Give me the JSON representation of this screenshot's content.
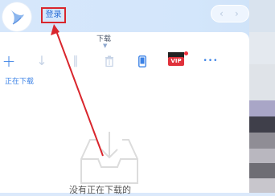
{
  "header": {
    "login_label": "登录",
    "back_symbol": "‹",
    "forward_symbol": "›"
  },
  "tabs": {
    "active_label": "下载"
  },
  "toolbar": {
    "items": [
      {
        "icon": "plus-icon",
        "glyph": "+",
        "enabled": true
      },
      {
        "icon": "download-arrow-icon",
        "glyph": "↓",
        "enabled": false
      },
      {
        "icon": "pause-icon",
        "glyph": "‖",
        "enabled": false
      },
      {
        "icon": "trash-icon",
        "glyph": "🗑",
        "enabled": false
      },
      {
        "icon": "phone-icon",
        "glyph": "📱",
        "enabled": true
      },
      {
        "icon": "vip-icon",
        "glyph": "VIP",
        "enabled": true
      },
      {
        "icon": "more-icon",
        "glyph": "•••",
        "enabled": true
      }
    ],
    "vip_label": "VIP"
  },
  "section": {
    "label": "正在下载"
  },
  "empty_state": {
    "text": "没有正在下载的"
  },
  "colors": {
    "accent": "#3b82e6",
    "highlight_box": "#d9262d",
    "vip_red": "#e0313b"
  }
}
